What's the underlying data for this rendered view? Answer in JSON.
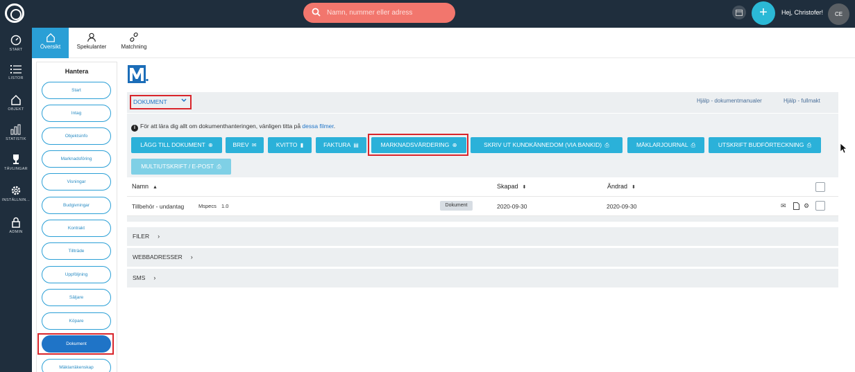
{
  "topbar": {
    "search_placeholder": "Namn, nummer eller adress",
    "greeting": "Hej, Christofer!",
    "avatar_initials": "CE",
    "accent_color": "#2bb9d6",
    "search_color": "#f2766d"
  },
  "leftnav": {
    "items": [
      {
        "label": "START",
        "icon": "gauge-icon"
      },
      {
        "label": "LISTOR",
        "icon": "list-icon"
      },
      {
        "label": "OBJEKT",
        "icon": "house-icon"
      },
      {
        "label": "STATISTIK",
        "icon": "bar-chart-icon"
      },
      {
        "label": "TÄVLINGAR",
        "icon": "trophy-icon"
      },
      {
        "label": "INSTÄLLNIN...",
        "icon": "gear-icon"
      },
      {
        "label": "ADMIN",
        "icon": "lock-icon"
      }
    ]
  },
  "subnav": {
    "tabs": [
      {
        "label": "Översikt",
        "icon": "house-icon"
      },
      {
        "label": "Spekulanter",
        "icon": "person-icon"
      },
      {
        "label": "Matchning",
        "icon": "link-icon"
      }
    ]
  },
  "manage": {
    "title": "Hantera",
    "items": [
      "Start",
      "Intag",
      "Objektsinfo",
      "Marknadsföring",
      "Visningar",
      "Budgivningar",
      "Kontrakt",
      "Tillträde",
      "Uppföljning",
      "Säljare",
      "Köpare",
      "Dokument",
      "Mäklarräkenskap"
    ],
    "active": "Dokument"
  },
  "documents": {
    "selector": "DOKUMENT",
    "help_links": [
      "Hjälp - dokumentmanualer",
      "Hjälp - fullmakt"
    ],
    "info_prefix": "För att lära dig allt om dokumenthanteringen, vänligen titta på ",
    "info_link": "dessa filmer",
    "info_suffix": ".",
    "buttons": [
      {
        "label": "LÄGG TILL DOKUMENT",
        "icon": "⊕"
      },
      {
        "label": "BREV",
        "icon": "✉"
      },
      {
        "label": "KVITTO",
        "icon": "▮"
      },
      {
        "label": "FAKTURA",
        "icon": "▤"
      },
      {
        "label": "MARKNADSVÄRDERING",
        "icon": "⊕"
      },
      {
        "label": "SKRIV UT KUNDKÄNNEDOM (VIA BANKID)",
        "icon": "⎙"
      },
      {
        "label": "MÄKLARJOURNAL",
        "icon": "⎙"
      },
      {
        "label": "UTSKRIFT BUDFÖRTECKNING",
        "icon": "⎙"
      },
      {
        "label": "MULTIUTSKRIFT / E-POST",
        "icon": "⎙"
      }
    ],
    "table": {
      "columns": [
        "Namn",
        "Skapad",
        "Ändrad"
      ],
      "rows": [
        {
          "name": "Tillbehör - undantag",
          "source": "Mspecs",
          "version": "1.0",
          "tag": "Dokument",
          "created": "2020-09-30",
          "changed": "2020-09-30"
        }
      ]
    },
    "sections": [
      "FILER",
      "WEBBADRESSER",
      "SMS"
    ]
  }
}
